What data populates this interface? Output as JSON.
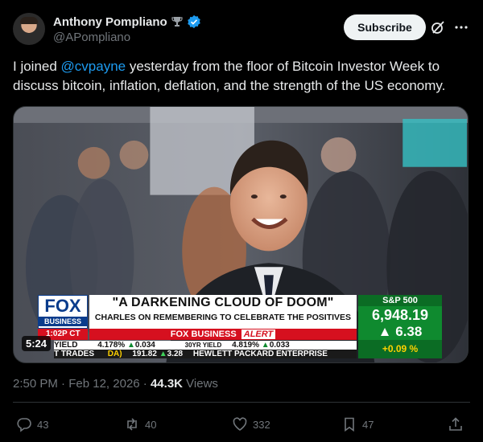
{
  "author": {
    "name": "Anthony Pompliano",
    "handle": "@APompliano",
    "badge_icon": "trophy-icon",
    "verified_icon": "verified-badge-icon",
    "verified_color": "#1d9bf0"
  },
  "header": {
    "subscribe_label": "Subscribe",
    "grok_icon": "grok-icon",
    "more_icon": "more-icon"
  },
  "tweet": {
    "text_before": "I joined ",
    "mention": "@cvpayne",
    "text_after": " yesterday from the floor of Bitcoin Investor Week to discuss bitcoin, inflation, deflation, and the strength of the US economy."
  },
  "video": {
    "duration": "5:24",
    "chyron": {
      "network": "FOX",
      "network_sub": "BUSINESS",
      "time": "1:02P CT",
      "headline": "\"A DARKENING CLOUD OF DOOM\"",
      "subhead": "CHARLES ON REMEMBERING TO CELEBRATE THE POSITIVES",
      "alert_brand": "FOX BUSINESS",
      "alert_word": "ALERT",
      "index_name": "S&P 500",
      "index_value": "6,948.19",
      "index_change": "6.38",
      "index_pct": "+0.09 %",
      "ticker": [
        {
          "label": "YIELD",
          "value": "4.178%",
          "change": "0.034"
        },
        {
          "label": "30YR YIELD",
          "value": "4.819%",
          "change": "0.033"
        }
      ],
      "ticker2_left": "T TRADES",
      "ticker2_symbol": "DA)",
      "ticker2_value": "191.82",
      "ticker2_change": "3.28",
      "ticker2_right": "HEWLETT PACKARD ENTERPRISE",
      "accent_red": "#d6101f",
      "accent_blue": "#0a3c8c",
      "accent_green": "#0f8a2f"
    }
  },
  "meta": {
    "time": "2:50 PM",
    "separator": " · ",
    "date": "Feb 12, 2026",
    "views_count": "44.3K",
    "views_label": " Views"
  },
  "actions": {
    "replies": "43",
    "reposts": "40",
    "likes": "332",
    "bookmarks": "47",
    "reply_icon": "reply-icon",
    "repost_icon": "repost-icon",
    "like_icon": "like-icon",
    "bookmark_icon": "bookmark-icon",
    "share_icon": "share-icon"
  }
}
